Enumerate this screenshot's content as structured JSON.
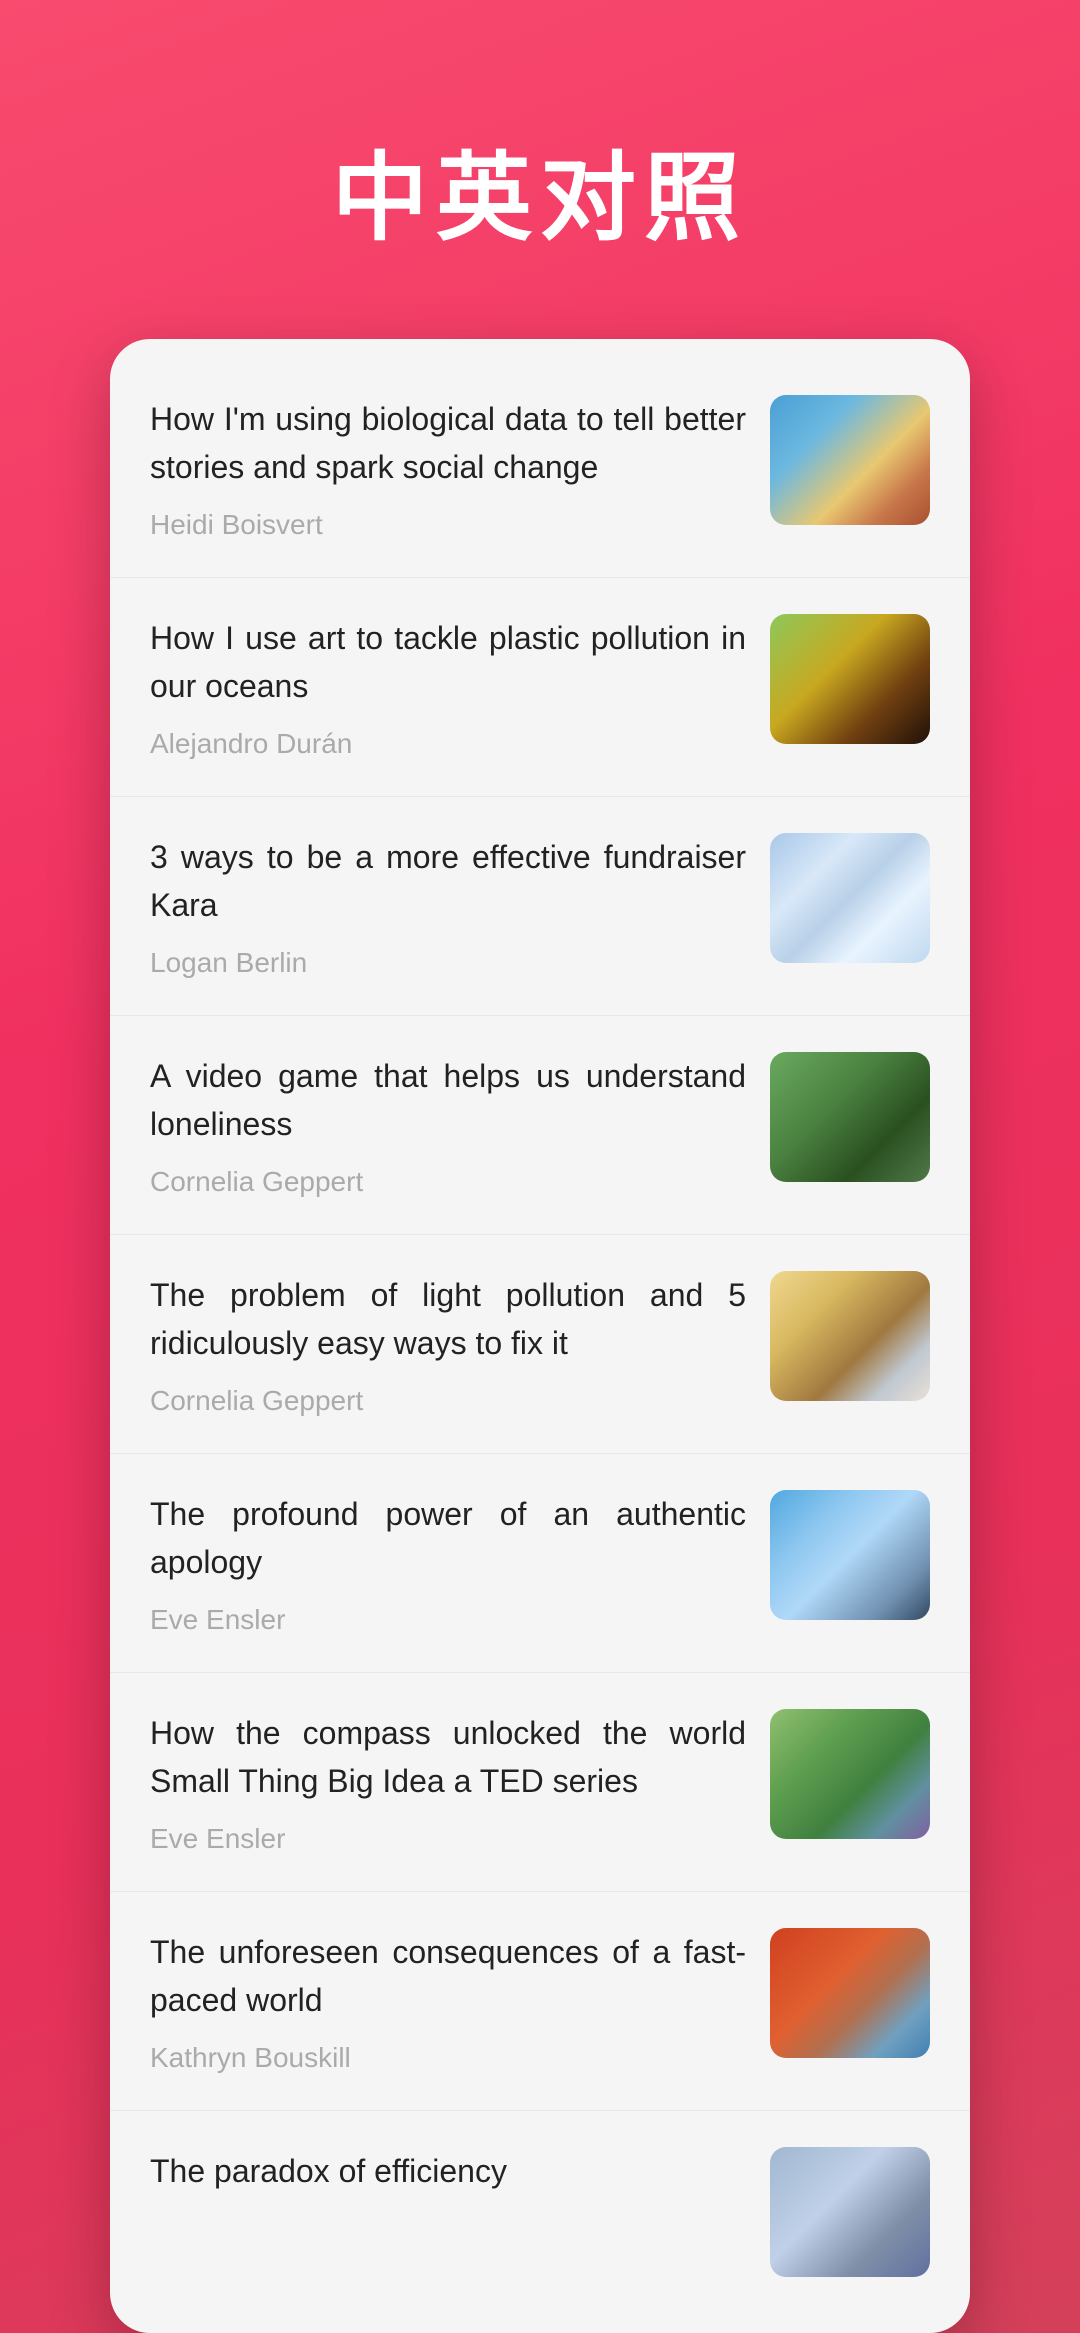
{
  "header": {
    "title": "中英对照"
  },
  "items": [
    {
      "id": 1,
      "title": "How I'm using biological data to tell better stories and spark social change",
      "author": "Heidi Boisvert",
      "thumb_class": "thumb-1"
    },
    {
      "id": 2,
      "title": "How I use art to tackle plastic pollution in our oceans",
      "author": "Alejandro Durán",
      "thumb_class": "thumb-2"
    },
    {
      "id": 3,
      "title": "3 ways to be a more effective fundraiser Kara",
      "author": "Logan Berlin",
      "thumb_class": "thumb-3"
    },
    {
      "id": 4,
      "title": "A video game that helps us understand loneliness",
      "author": "Cornelia Geppert",
      "thumb_class": "thumb-4"
    },
    {
      "id": 5,
      "title": "The problem of light pollution and 5 ridiculously easy ways to fix it",
      "author": "Cornelia Geppert",
      "thumb_class": "thumb-5"
    },
    {
      "id": 6,
      "title": "The profound power of an authentic apology",
      "author": "Eve Ensler",
      "thumb_class": "thumb-6"
    },
    {
      "id": 7,
      "title": "How the compass unlocked the world Small Thing Big Idea a TED series",
      "author": "Eve Ensler",
      "thumb_class": "thumb-7"
    },
    {
      "id": 8,
      "title": "The unforeseen consequences of a fast-paced world",
      "author": "Kathryn Bouskill",
      "thumb_class": "thumb-8"
    },
    {
      "id": 9,
      "title": "The paradox of efficiency",
      "author": "",
      "thumb_class": "thumb-9"
    }
  ]
}
